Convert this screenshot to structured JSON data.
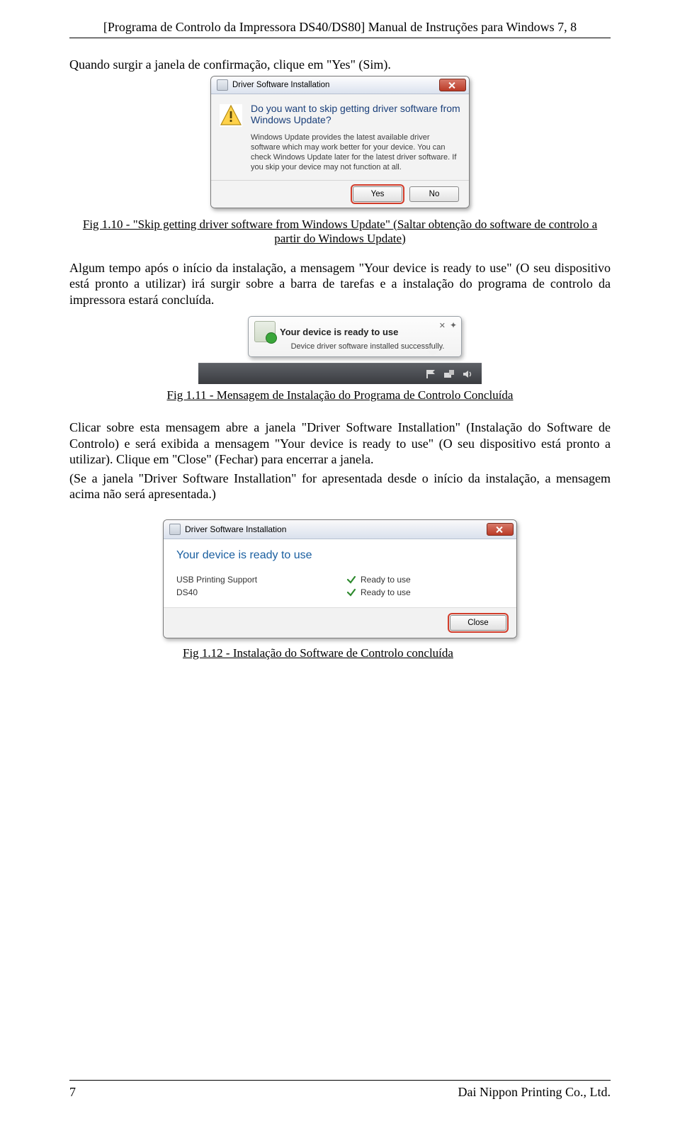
{
  "header": "[Programa de Controlo da Impressora DS40/DS80] Manual de Instruções para Windows 7, 8",
  "para1": "Quando surgir a janela de confirmação, clique em \"Yes\" (Sim).",
  "dialog1": {
    "title": "Driver Software Installation",
    "heading": "Do you want to skip getting driver software from Windows Update?",
    "body": "Windows Update provides the latest available driver software which may work better for your device. You can check Windows Update later for the latest driver software. If you skip your device may not function at all.",
    "yes": "Yes",
    "no": "No"
  },
  "caption110": "Fig 1.10 - \"Skip getting driver software from Windows Update\" (Saltar obtenção do software de controlo a partir do Windows Update)",
  "para2": "Algum tempo após o início da instalação, a mensagem \"Your device is ready to use\" (O seu dispositivo está pronto a utilizar) irá surgir sobre a barra de tarefas e a instalação do programa de controlo da impressora estará concluída.",
  "balloon": {
    "title": "Your device is ready to use",
    "sub": "Device driver software installed successfully."
  },
  "caption111": "Fig 1.11 - Mensagem de Instalação do Programa de Controlo Concluída",
  "para3a": "Clicar sobre esta mensagem abre a janela \"Driver Software Installation\" (Instalação do Software de Controlo) e será exibida a mensagem \"Your device is ready to use\" (O seu dispositivo está pronto a utilizar). Clique em \"Close\" (Fechar) para encerrar a janela.",
  "para3b": "(Se a janela \"Driver Software Installation\" for apresentada desde o início da instalação, a mensagem acima não será apresentada.)",
  "dialog3": {
    "title": "Driver Software Installation",
    "heading": "Your device is ready to use",
    "items": [
      {
        "name": "USB Printing Support",
        "status": "Ready to use"
      },
      {
        "name": "DS40",
        "status": "Ready to use"
      }
    ],
    "close": "Close"
  },
  "caption112": "Fig 1.12 - Instalação do Software de Controlo concluída",
  "footer": {
    "page": "7",
    "company": "Dai Nippon Printing Co., Ltd."
  }
}
